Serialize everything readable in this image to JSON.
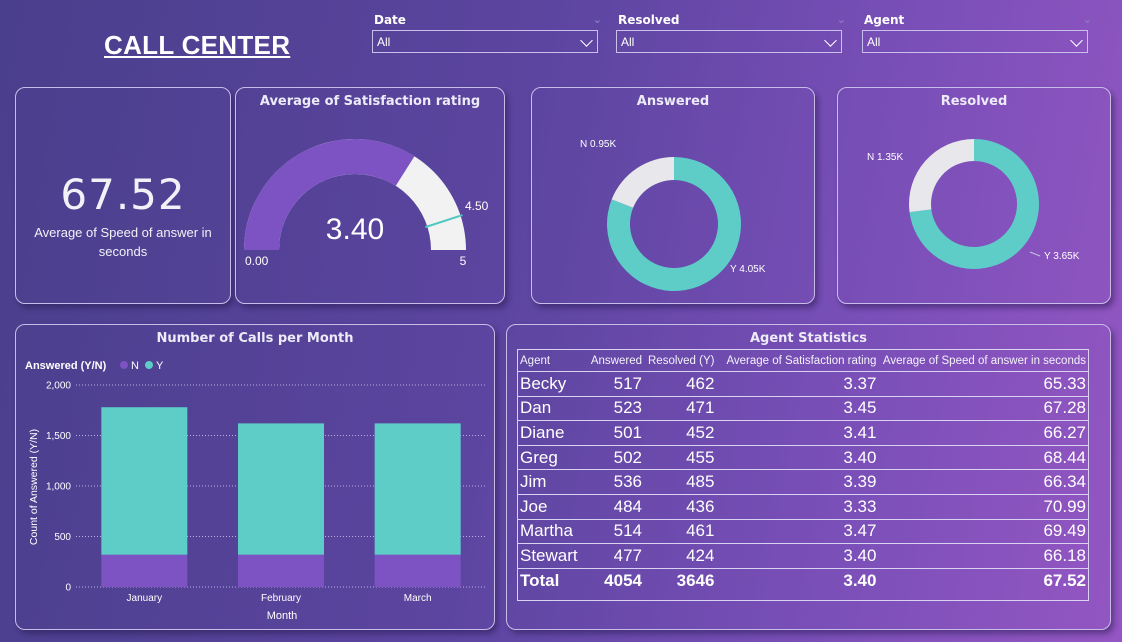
{
  "header": {
    "title": "CALL CENTER"
  },
  "slicers": [
    {
      "label": "Date",
      "value": "All"
    },
    {
      "label": "Resolved",
      "value": "All"
    },
    {
      "label": "Agent",
      "value": "All"
    }
  ],
  "kpi": {
    "value": "67.52",
    "label": "Average of Speed of answer in seconds"
  },
  "gauge": {
    "title": "Average of Satisfaction rating",
    "value": 3.4,
    "value_label": "3.40",
    "min": 0,
    "min_label": "0.00",
    "max": 5,
    "max_label": "5",
    "target": 4.5,
    "target_label": "4.50",
    "fill_color": "#7d52c3",
    "track_color": "#f2f2f2",
    "target_color": "#4fc8c3"
  },
  "donut_answered": {
    "title": "Answered",
    "slices": [
      {
        "name": "N",
        "value": 0.95,
        "label": "N 0.95K",
        "color": "#e8e8ec"
      },
      {
        "name": "Y",
        "value": 4.05,
        "label": "Y 4.05K",
        "color": "#5ecdc8"
      }
    ]
  },
  "donut_resolved": {
    "title": "Resolved",
    "slices": [
      {
        "name": "N",
        "value": 1.35,
        "label": "N 1.35K",
        "color": "#e8e8ec"
      },
      {
        "name": "Y",
        "value": 3.65,
        "label": "Y 3.65K",
        "color": "#5ecdc8"
      }
    ]
  },
  "calls_chart": {
    "title": "Number of Calls per Month",
    "legend_title": "Answered (Y/N)",
    "chart_data": {
      "type": "bar",
      "stacked": true,
      "categories": [
        "January",
        "February",
        "March"
      ],
      "series": [
        {
          "name": "N",
          "values": [
            320,
            320,
            320
          ],
          "color": "#7d52c3"
        },
        {
          "name": "Y",
          "values": [
            1460,
            1300,
            1300
          ],
          "color": "#5ecdc8"
        }
      ],
      "xlabel": "Month",
      "ylabel": "Count of Answered (Y/N)",
      "ylim": [
        0,
        2000
      ],
      "yticks": [
        0,
        500,
        1000,
        1500,
        2000
      ],
      "ytick_labels": [
        "0",
        "500",
        "1,000",
        "1,500",
        "2,000"
      ],
      "grid": true,
      "legend_position": "top-left"
    }
  },
  "agent_stats": {
    "title": "Agent Statistics",
    "columns": [
      "Agent",
      "Answered",
      "Resolved (Y)",
      "Average of Satisfaction rating",
      "Average of Speed of answer in seconds"
    ],
    "rows": [
      [
        "Becky",
        "517",
        "462",
        "3.37",
        "65.33"
      ],
      [
        "Dan",
        "523",
        "471",
        "3.45",
        "67.28"
      ],
      [
        "Diane",
        "501",
        "452",
        "3.41",
        "66.27"
      ],
      [
        "Greg",
        "502",
        "455",
        "3.40",
        "68.44"
      ],
      [
        "Jim",
        "536",
        "485",
        "3.39",
        "66.34"
      ],
      [
        "Joe",
        "484",
        "436",
        "3.33",
        "70.99"
      ],
      [
        "Martha",
        "514",
        "461",
        "3.47",
        "69.49"
      ],
      [
        "Stewart",
        "477",
        "424",
        "3.40",
        "66.18"
      ]
    ],
    "total": [
      "Total",
      "4054",
      "3646",
      "3.40",
      "67.52"
    ]
  }
}
